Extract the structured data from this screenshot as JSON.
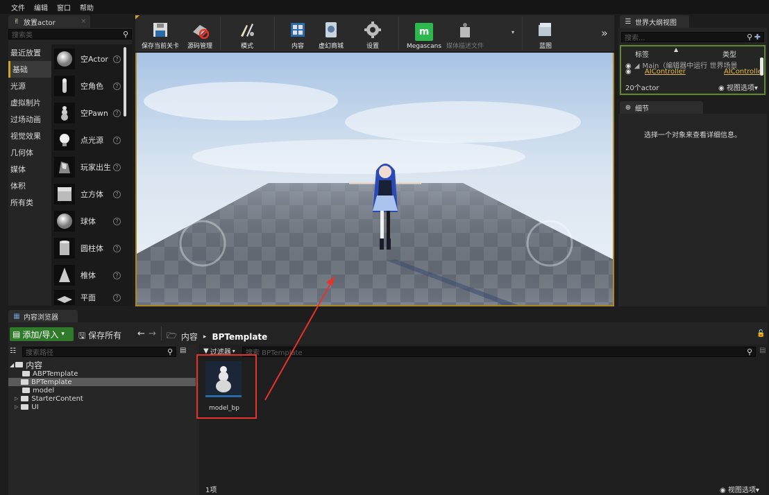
{
  "menu": {
    "items": [
      "文件",
      "编辑",
      "窗口",
      "帮助"
    ]
  },
  "place_actor": {
    "tab": "放置actor",
    "search_placeholder": "搜索类",
    "categories": [
      "最近放置",
      "基础",
      "光源",
      "虚拟制片",
      "过场动画",
      "视觉效果",
      "几何体",
      "媒体",
      "体积",
      "所有类"
    ],
    "items": [
      "空Actor",
      "空角色",
      "空Pawn",
      "点光源",
      "玩家出生",
      "立方体",
      "球体",
      "圆柱体",
      "椎体",
      "平面"
    ]
  },
  "toolbar": {
    "buttons": [
      "保存当前关卡",
      "源码管理",
      "模式",
      "内容",
      "虚幻商城",
      "设置",
      "Megascans",
      "媒体描述文件",
      "蓝图"
    ],
    "overflow": "»"
  },
  "outliner": {
    "tab": "世界大纲视图",
    "search_placeholder": "搜索...",
    "col_label": "标签",
    "col_type": "类型",
    "rows": [
      {
        "label": "Main（编辑器中运行 世界场景",
        "type": ""
      },
      {
        "label": "AIController",
        "type": "AIController"
      }
    ],
    "count": "20个actor",
    "view_options": "视图选项▾"
  },
  "details": {
    "tab": "细节",
    "empty_msg": "选择一个对象来查看详细信息。"
  },
  "content_browser": {
    "tab": "内容浏览器",
    "add_import": "添加/导入",
    "save_all": "保存所有",
    "breadcrumb": [
      "内容",
      "BPTemplate"
    ],
    "path_search_placeholder": "搜索路径",
    "filters": "过滤器",
    "asset_search_placeholder": "搜索 BPTemplate",
    "tree": [
      {
        "label": "内容",
        "level": 0
      },
      {
        "label": "ABPTemplate",
        "level": 1
      },
      {
        "label": "BPTemplate",
        "level": 1,
        "selected": true
      },
      {
        "label": "model",
        "level": 1
      },
      {
        "label": "StarterContent",
        "level": 1
      },
      {
        "label": "UI",
        "level": 1
      }
    ],
    "assets": [
      {
        "name": "model_bp"
      }
    ],
    "item_count": "1项",
    "view_options": "视图选项▾"
  },
  "colors": {
    "accent": "#d4a32b",
    "selected_blue": "#2a6aa6",
    "annotation_red": "#e8332b",
    "megascans_green": "#2db84e",
    "outliner_border": "#5f8a2f"
  }
}
